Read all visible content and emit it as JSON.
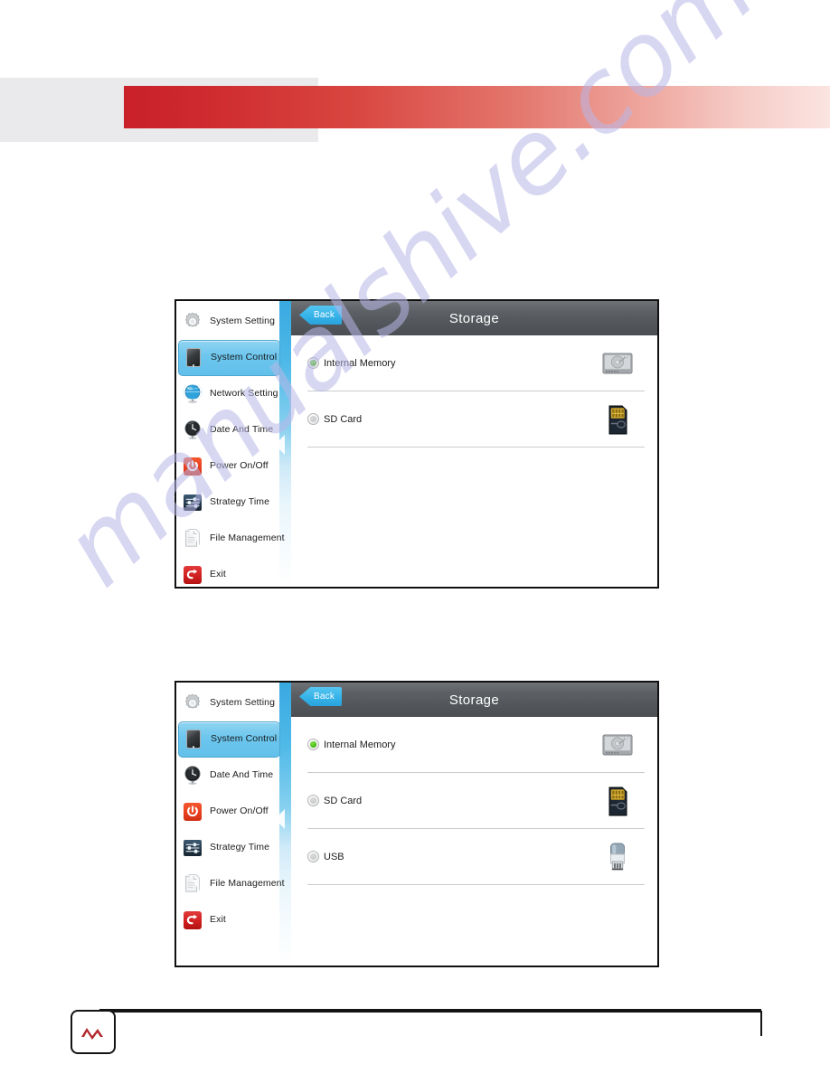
{
  "page": {
    "watermark": "manualshive.com",
    "header": {
      "gray_block": "decorative-gray-block",
      "red_bar": "decorative-red-gradient-bar",
      "accent_color": "#c9202a"
    },
    "footer": {
      "logo_alt": "AV-logo",
      "rule": "footer-divider-rule"
    }
  },
  "screenshots": [
    {
      "id": "screenshot-1",
      "sidebar": {
        "items": [
          {
            "label": "System Setting",
            "icon": "gear-icon",
            "selected": false
          },
          {
            "label": "System Control",
            "icon": "tablet-icon",
            "selected": true
          },
          {
            "label": "Network Setting",
            "icon": "globe-icon",
            "selected": false
          },
          {
            "label": "Date And Time",
            "icon": "clock-icon",
            "selected": false
          },
          {
            "label": "Power On/Off",
            "icon": "power-icon",
            "selected": false
          },
          {
            "label": "Strategy Time",
            "icon": "sliders-icon",
            "selected": false
          },
          {
            "label": "File Management",
            "icon": "documents-icon",
            "selected": false
          },
          {
            "label": "Exit",
            "icon": "exit-arrow-icon",
            "selected": false
          }
        ]
      },
      "titlebar": {
        "back_label": "Back",
        "title": "Storage"
      },
      "options": [
        {
          "label": "Internal Memory",
          "selected": true,
          "device_icon": "hard-disk-icon"
        },
        {
          "label": "SD Card",
          "selected": false,
          "device_icon": "sd-card-icon"
        }
      ]
    },
    {
      "id": "screenshot-2",
      "sidebar": {
        "items": [
          {
            "label": "System Setting",
            "icon": "gear-icon",
            "selected": false
          },
          {
            "label": "System Control",
            "icon": "tablet-icon",
            "selected": true
          },
          {
            "label": "Date And Time",
            "icon": "clock-icon",
            "selected": false
          },
          {
            "label": "Power On/Off",
            "icon": "power-icon",
            "selected": false
          },
          {
            "label": "Strategy Time",
            "icon": "sliders-icon",
            "selected": false
          },
          {
            "label": "File Management",
            "icon": "documents-icon",
            "selected": false
          },
          {
            "label": "Exit",
            "icon": "exit-arrow-icon",
            "selected": false
          }
        ]
      },
      "titlebar": {
        "back_label": "Back",
        "title": "Storage"
      },
      "options": [
        {
          "label": "Internal Memory",
          "selected": true,
          "device_icon": "hard-disk-icon"
        },
        {
          "label": "SD Card",
          "selected": false,
          "device_icon": "sd-card-icon"
        },
        {
          "label": "USB",
          "selected": false,
          "device_icon": "usb-drive-icon"
        }
      ]
    }
  ]
}
